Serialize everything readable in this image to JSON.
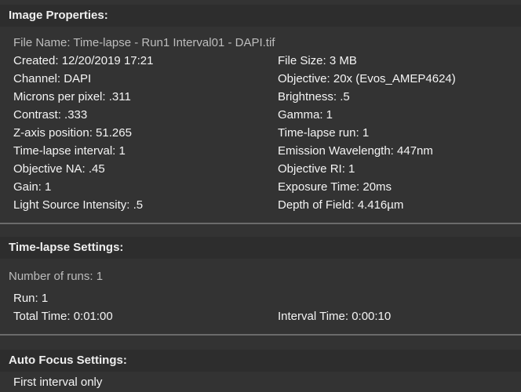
{
  "image_properties": {
    "header": "Image Properties:",
    "file_name": "File Name: Time-lapse - Run1 Interval01 - DAPI.tif",
    "left": [
      "Created: 12/20/2019  17:21",
      "Channel: DAPI",
      "Microns per pixel: .311",
      "Contrast: .333",
      "Z-axis position: 51.265",
      "Time-lapse interval: 1",
      "Objective NA: .45",
      "Gain: 1",
      "Light Source Intensity: .5"
    ],
    "right": [
      "File Size: 3 MB",
      "Objective: 20x (Evos_AMEP4624)",
      "Brightness: .5",
      "Gamma: 1",
      "Time-lapse run: 1",
      "Emission Wavelength: 447nm",
      "Objective RI: 1",
      "Exposure Time: 20ms",
      "Depth of Field: 4.416µm"
    ]
  },
  "timelapse_settings": {
    "header": "Time-lapse Settings:",
    "number_of_runs": "Number of runs: 1",
    "run": "Run: 1",
    "total_time": "Total Time: 0:01:00",
    "interval_time": "Interval Time: 0:00:10"
  },
  "auto_focus_settings": {
    "header": "Auto Focus Settings:",
    "mode": "First interval only"
  }
}
